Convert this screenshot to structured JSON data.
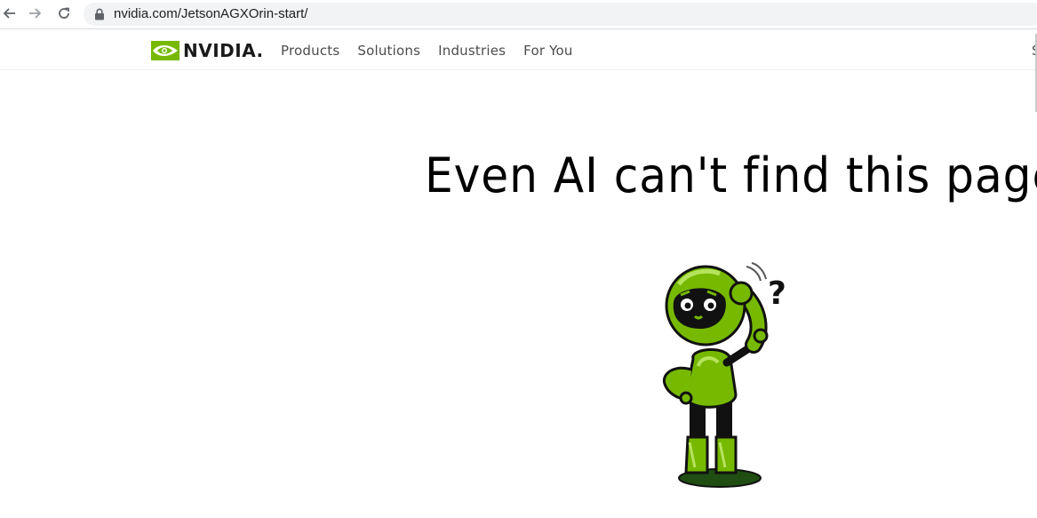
{
  "browser": {
    "url": "nvidia.com/JetsonAGXOrin-start/",
    "back_icon": "arrow-left-icon",
    "forward_icon": "arrow-right-icon",
    "reload_icon": "reload-icon",
    "lock_icon": "lock-icon"
  },
  "header": {
    "logo_text": "NVIDIA.",
    "logo_color": "#76b900",
    "nav_items": [
      {
        "label": "Products"
      },
      {
        "label": "Solutions"
      },
      {
        "label": "Industries"
      },
      {
        "label": "For You"
      }
    ],
    "cut_text": "S"
  },
  "main": {
    "headline": "Even AI can't find this page!",
    "illustration": "confused-robot-illustration",
    "illustration_mark": "?",
    "illustration_color": "#76b900"
  }
}
